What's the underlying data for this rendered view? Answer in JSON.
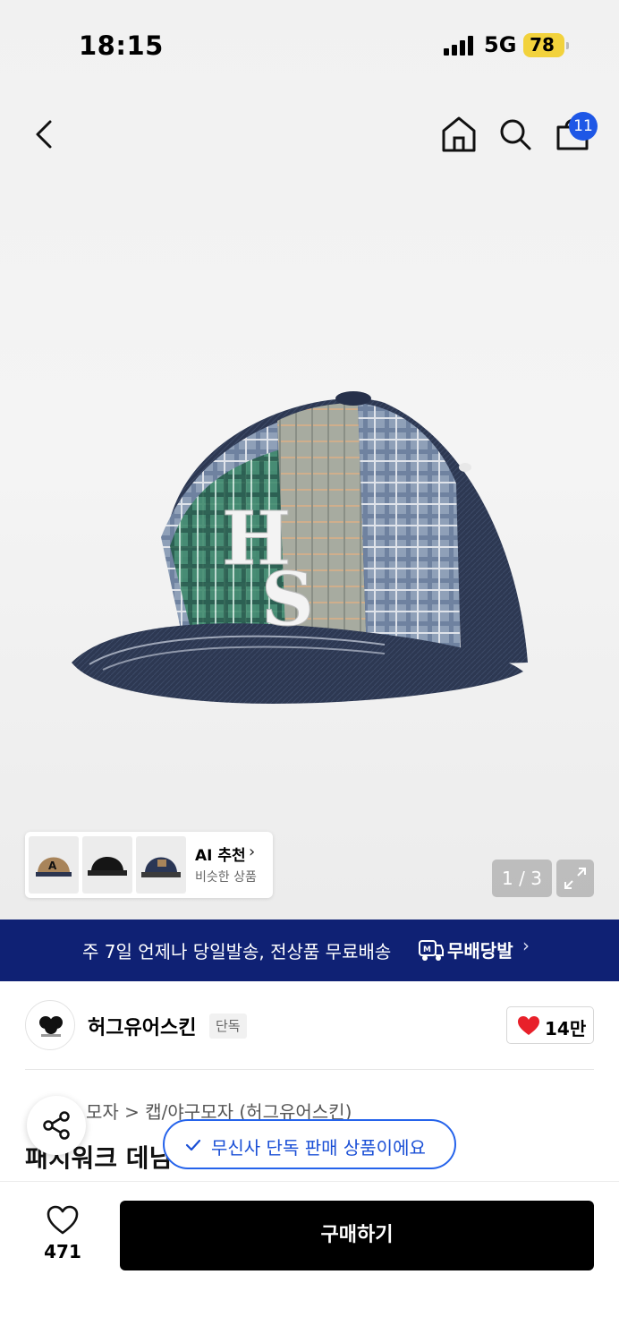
{
  "status_bar": {
    "time": "18:15",
    "network": "5G",
    "battery": "78"
  },
  "nav": {
    "cart_count": "11"
  },
  "gallery": {
    "counter": "1 / 3",
    "ai_title": "AI 추천",
    "ai_subtitle": "비슷한 상품"
  },
  "banner": {
    "text": "주 7일 언제나 당일발송, 전상품 무료배송",
    "logo_text": "무배당발"
  },
  "brand": {
    "name": "허그유어스킨",
    "tag": "단독",
    "likes": "14만"
  },
  "product": {
    "breadcrumb": "모자 > 캡/야구모자 (허그유어스킨)",
    "title_partial": "패치워크 데님"
  },
  "toast": {
    "text": "무신사 단독 판매 상품이에요"
  },
  "bottom": {
    "wish_count": "471",
    "buy_label": "구매하기"
  },
  "colors": {
    "banner_bg": "#0f2174",
    "badge": "#1e57e6",
    "toast_accent": "#2563eb",
    "battery": "#f2d23c"
  }
}
